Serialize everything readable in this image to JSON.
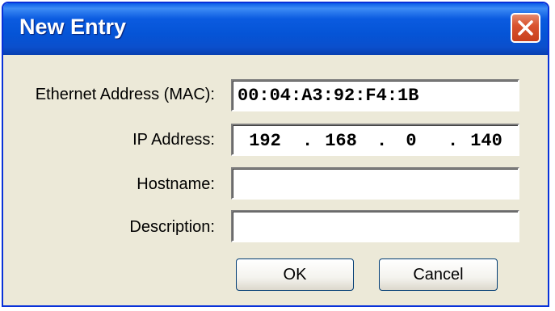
{
  "dialog": {
    "title": "New Entry"
  },
  "form": {
    "mac_label": "Ethernet Address (MAC):",
    "mac_value": "00:04:A3:92:F4:1B",
    "ip_label": "IP Address:",
    "ip_octets": [
      "192",
      "168",
      "0",
      "140"
    ],
    "ip_separator": ".",
    "hostname_label": "Hostname:",
    "hostname_value": "",
    "description_label": "Description:",
    "description_value": ""
  },
  "buttons": {
    "ok_label": "OK",
    "cancel_label": "Cancel"
  },
  "icons": {
    "close": "close-icon"
  },
  "colors": {
    "titlebar": "#0554d6",
    "dialog_bg": "#ece9d8",
    "close_button": "#d9542f"
  }
}
